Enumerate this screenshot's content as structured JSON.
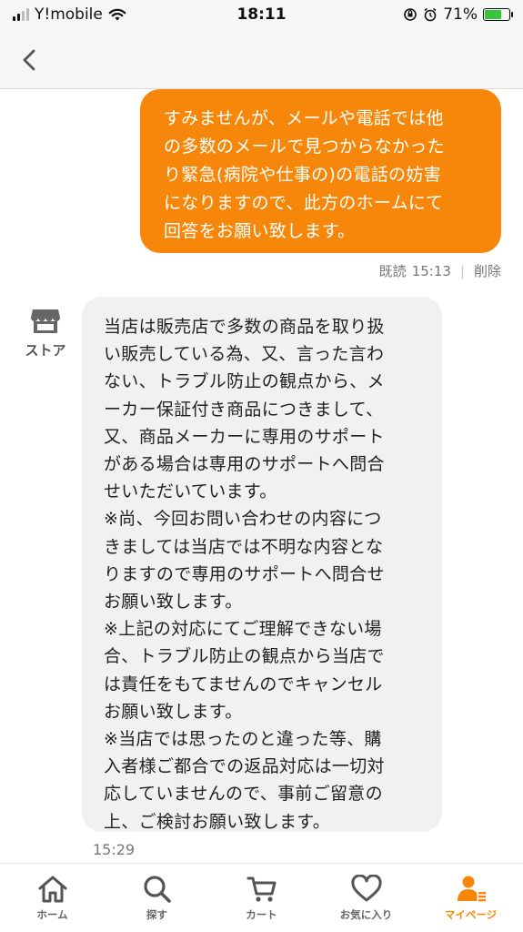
{
  "status_bar": {
    "carrier": "Y!mobile",
    "time": "18:11",
    "battery_percent": "71%"
  },
  "messages": {
    "outgoing": {
      "lines": [
        "すみませんが、メールや電話では他",
        "の多数のメールで見つからなかった",
        "り緊急(病院や仕事の)の電話の妨害",
        "になりますので、此方のホームにて",
        "回答をお願い致します。"
      ],
      "read_label": "既読",
      "time": "15:13",
      "delete_label": "削除"
    },
    "incoming": {
      "sender_label": "ストア",
      "lines": [
        "当店は販売店で多数の商品を取り扱",
        "い販売している為、又、言った言わ",
        "ない、トラブル防止の観点から、メ",
        "ーカー保証付き商品につきまして、",
        "又、商品メーカーに専用のサポート",
        "がある場合は専用のサポートへ問合",
        "せいただいています。",
        "※尚、今回お問い合わせの内容につ",
        "きましては当店では不明な内容とな",
        "りますので専用のサポートへ問合せ",
        "お願い致します。",
        "※上記の対応にてご理解できない場",
        "合、トラブル防止の観点から当店で",
        "は責任をもてませんのでキャンセル",
        "お願い致します。",
        "※当店では思ったのと違った等、購",
        "入者様ご都合での返品対応は一切対",
        "応していませんので、事前ご留意の",
        "上、ご検討お願い致します。"
      ],
      "time": "15:29"
    }
  },
  "tab_bar": {
    "items": [
      {
        "label": "ホーム",
        "icon": "home-icon"
      },
      {
        "label": "探す",
        "icon": "search-icon"
      },
      {
        "label": "カート",
        "icon": "cart-icon"
      },
      {
        "label": "お気に入り",
        "icon": "heart-icon"
      },
      {
        "label": "マイページ",
        "icon": "user-icon"
      }
    ],
    "active_index": 4
  },
  "colors": {
    "accent": "#f7870a",
    "incoming_bubble": "#f1f1f1",
    "header_bg": "#f6f6f6"
  }
}
